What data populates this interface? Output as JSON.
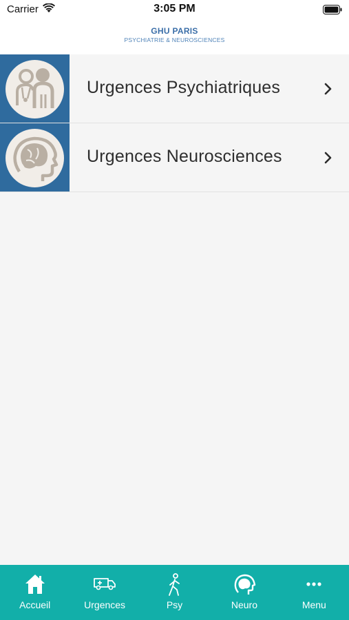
{
  "status_bar": {
    "carrier": "Carrier",
    "time": "3:05 PM"
  },
  "header": {
    "brand": "GHU PARIS",
    "tagline": "PSYCHIATRIE & NEUROSCIENCES"
  },
  "menu": {
    "items": [
      {
        "label": "Urgences Psychiatriques",
        "icon": "psychiatry-people-icon"
      },
      {
        "label": "Urgences Neurosciences",
        "icon": "brain-head-icon"
      }
    ]
  },
  "tabs": [
    {
      "label": "Accueil",
      "icon": "home-icon"
    },
    {
      "label": "Urgences",
      "icon": "ambulance-icon"
    },
    {
      "label": "Psy",
      "icon": "walking-person-icon"
    },
    {
      "label": "Neuro",
      "icon": "brain-head-icon"
    },
    {
      "label": "Menu",
      "icon": "more-dots-icon"
    }
  ],
  "colors": {
    "thumb_blue": "#2f6b9e",
    "tab_teal": "#12afa9",
    "brand_blue": "#3a6ea8"
  }
}
